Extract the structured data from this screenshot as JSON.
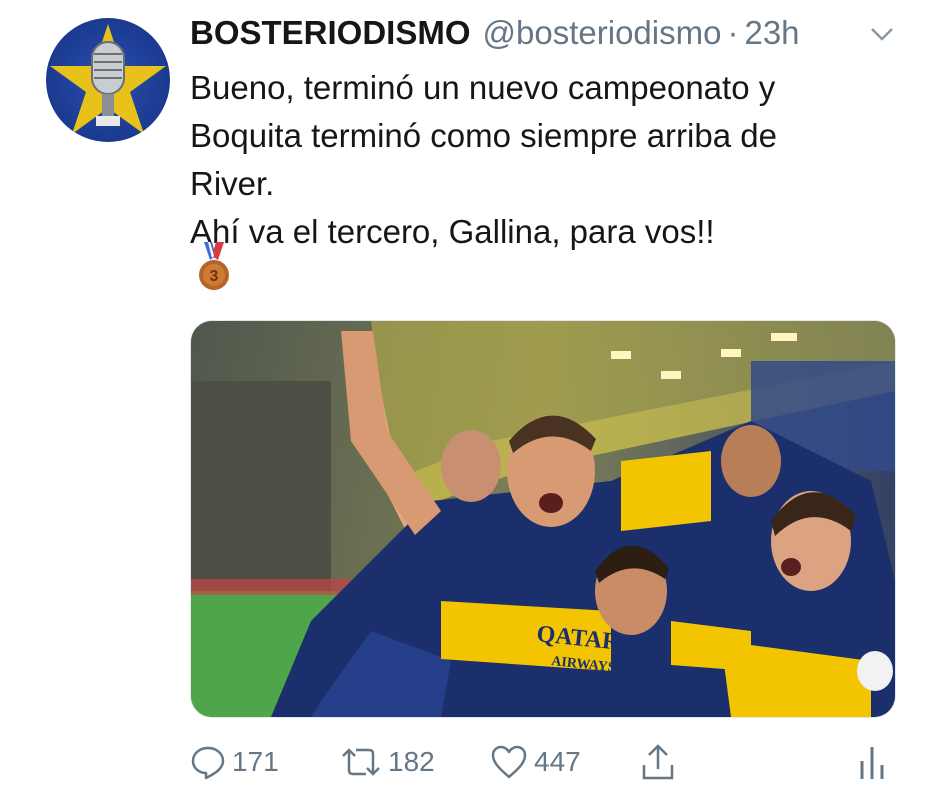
{
  "tweet": {
    "display_name": "BOSTERIODISMO",
    "handle": "@bosteriodismo",
    "separator": "·",
    "time": "23h",
    "text_lines": [
      "Bueno, terminó un nuevo campeonato y",
      "Boquita terminó como siempre arriba de",
      "River.",
      "Ahí va el tercero, Gallina, para vos!!"
    ],
    "medal_number": "3",
    "media": {
      "jersey_sponsor_1": "QATAR",
      "jersey_sponsor_2": "AIRWAYS"
    }
  },
  "actions": {
    "replies": "171",
    "retweets": "182",
    "likes": "447"
  },
  "colors": {
    "text": "#14171a",
    "secondary": "#657786",
    "boca_blue": "#1a2f6b",
    "boca_yellow": "#f2c500"
  },
  "icons": [
    "avatar-microphone-star",
    "more-chevron-icon",
    "medal-icon",
    "reply-icon",
    "retweet-icon",
    "like-icon",
    "share-icon",
    "analytics-icon"
  ]
}
